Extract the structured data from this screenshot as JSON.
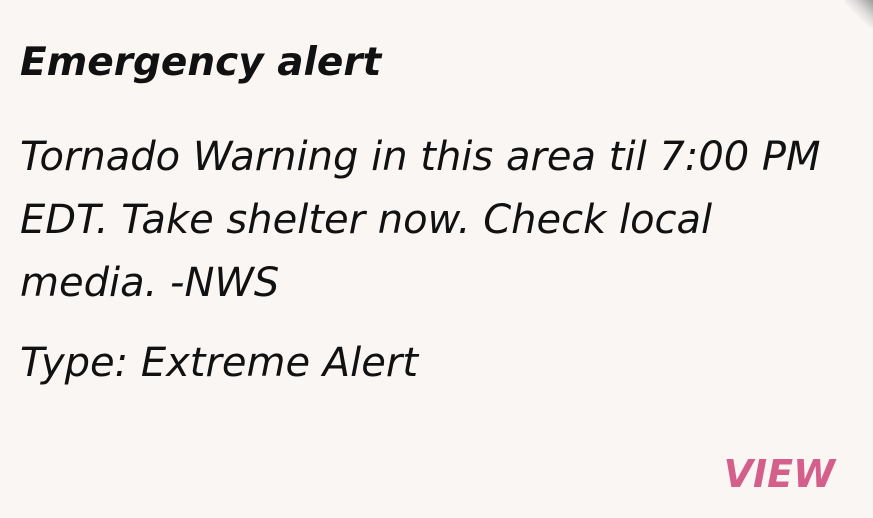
{
  "alert": {
    "title": "Emergency alert",
    "message": "Tornado Warning in this area til 7:00 PM EDT. Take shelter now. Check local media. -NWS",
    "type_text": "Type: Extreme Alert",
    "view_label": "VIEW"
  },
  "colors": {
    "background": "#faf6f4",
    "text": "#111111",
    "accent": "#d45f8a"
  }
}
